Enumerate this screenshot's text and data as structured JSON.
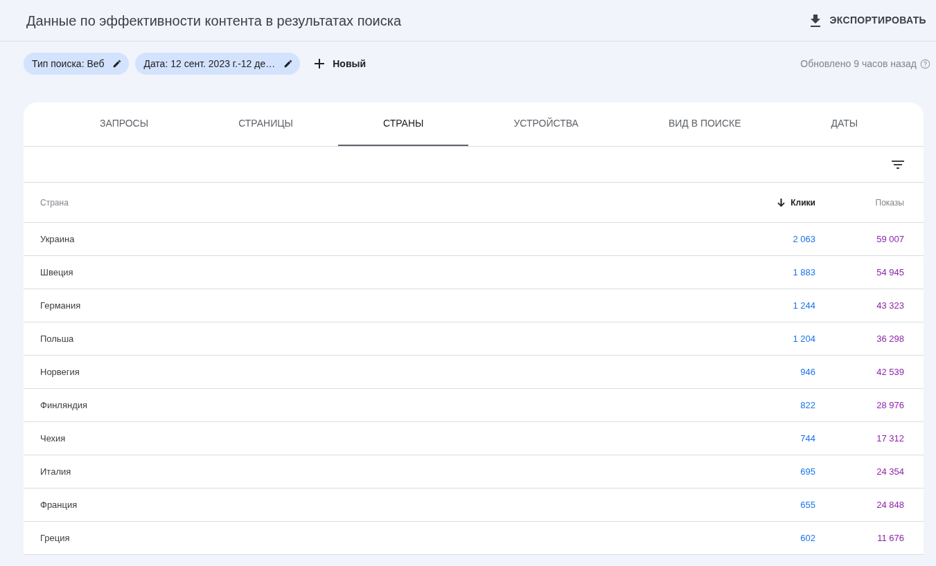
{
  "title": "Данные по эффективности контента в результатах поиска",
  "export_button": "ЭКСПОРТИРОВАТЬ",
  "filters": [
    {
      "label": "Тип поиска: Веб"
    },
    {
      "label": "Дата: 12 сент. 2023 г.-12 де…"
    }
  ],
  "new_filter_button": "Новый",
  "updated_note": "Обновлено 9 часов назад",
  "tabs": [
    {
      "label": "ЗАПРОСЫ",
      "selected": false
    },
    {
      "label": "СТРАНИЦЫ",
      "selected": false
    },
    {
      "label": "СТРАНЫ",
      "selected": true
    },
    {
      "label": "УСТРОЙСТВА",
      "selected": false
    },
    {
      "label": "ВИД В ПОИСКЕ",
      "selected": false
    },
    {
      "label": "ДАТЫ",
      "selected": false
    }
  ],
  "table": {
    "columns": [
      {
        "label": "Страна",
        "sorted": false
      },
      {
        "label": "Клики",
        "sorted": true
      },
      {
        "label": "Показы",
        "sorted": false
      }
    ],
    "rows": [
      [
        "Украина",
        "2 063",
        "59 007"
      ],
      [
        "Швеция",
        "1 883",
        "54 945"
      ],
      [
        "Германия",
        "1 244",
        "43 323"
      ],
      [
        "Польша",
        "1 204",
        "36 298"
      ],
      [
        "Норвегия",
        "946",
        "42 539"
      ],
      [
        "Финляндия",
        "822",
        "28 976"
      ],
      [
        "Чехия",
        "744",
        "17 312"
      ],
      [
        "Италия",
        "695",
        "24 354"
      ],
      [
        "Франция",
        "655",
        "24 848"
      ],
      [
        "Греция",
        "602",
        "11 676"
      ]
    ]
  }
}
